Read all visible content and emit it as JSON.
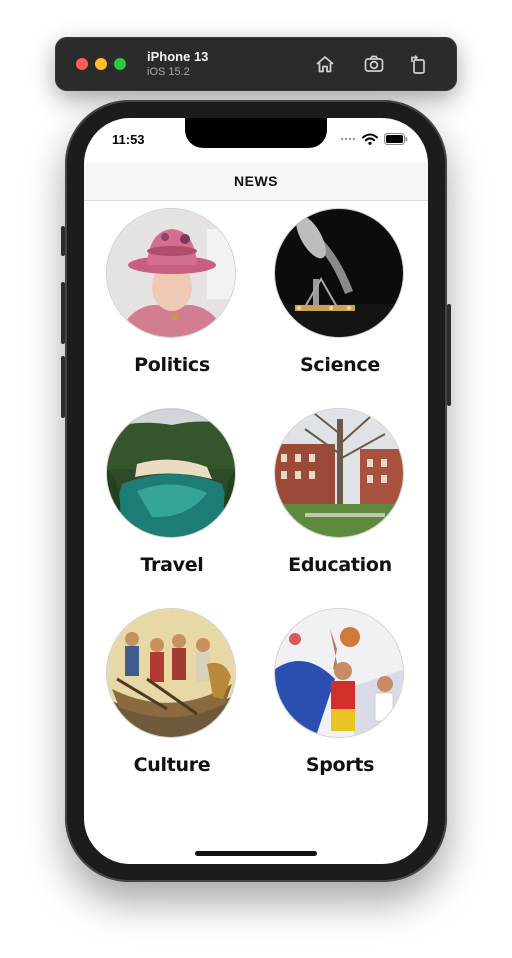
{
  "simulator": {
    "device": "iPhone 13",
    "os": "iOS 15.2"
  },
  "status_bar": {
    "time": "11:53"
  },
  "nav": {
    "title": "NEWS"
  },
  "categories": [
    {
      "label": "Politics"
    },
    {
      "label": "Science"
    },
    {
      "label": "Travel"
    },
    {
      "label": "Education"
    },
    {
      "label": "Culture"
    },
    {
      "label": "Sports"
    }
  ]
}
